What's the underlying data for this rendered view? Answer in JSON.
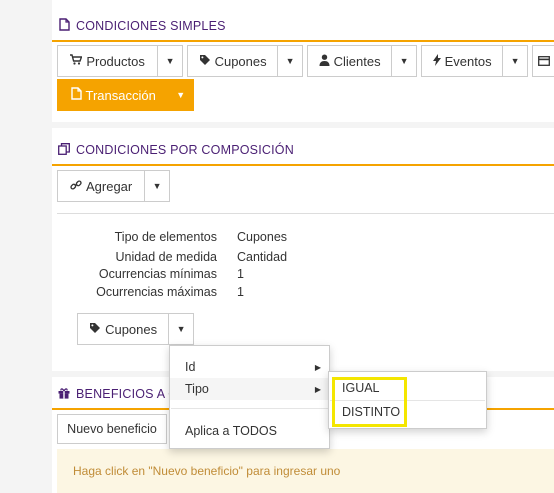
{
  "simple": {
    "title": "CONDICIONES SIMPLES",
    "icon": "file-icon",
    "buttons": [
      {
        "label": "Productos",
        "icon": "cart-icon"
      },
      {
        "label": "Cupones",
        "icon": "tag-icon"
      },
      {
        "label": "Clientes",
        "icon": "user-icon"
      },
      {
        "label": "Eventos",
        "icon": "bolt-icon"
      },
      {
        "label": "Transacción",
        "icon": "file-icon"
      }
    ],
    "accent_color": "#f5a300"
  },
  "composition": {
    "title": "CONDICIONES POR COMPOSICIÓN",
    "icon": "copy-icon",
    "add_button": "Agregar",
    "details": [
      {
        "key": "Tipo de elementos",
        "value": "Cupones"
      },
      {
        "key": "Unidad de medida",
        "value": "Cantidad"
      },
      {
        "key": "Ocurrencias mínimas",
        "value": "1"
      },
      {
        "key": "Ocurrencias máximas",
        "value": "1"
      }
    ],
    "element_button": "Cupones"
  },
  "benefits": {
    "title": "BENEFICIOS A O",
    "icon": "gift-icon",
    "new_button": "Nuevo beneficio",
    "hint": "Haga click en \"Nuevo beneficio\" para ingresar uno"
  },
  "menu": {
    "items": [
      "Id",
      "Tipo",
      "Aplica a TODOS"
    ]
  },
  "submenu": {
    "items": [
      "IGUAL",
      "DISTINTO"
    ]
  },
  "colors": {
    "title": "#4a1f73",
    "accent": "#f5a300",
    "highlight": "#f4e600"
  }
}
